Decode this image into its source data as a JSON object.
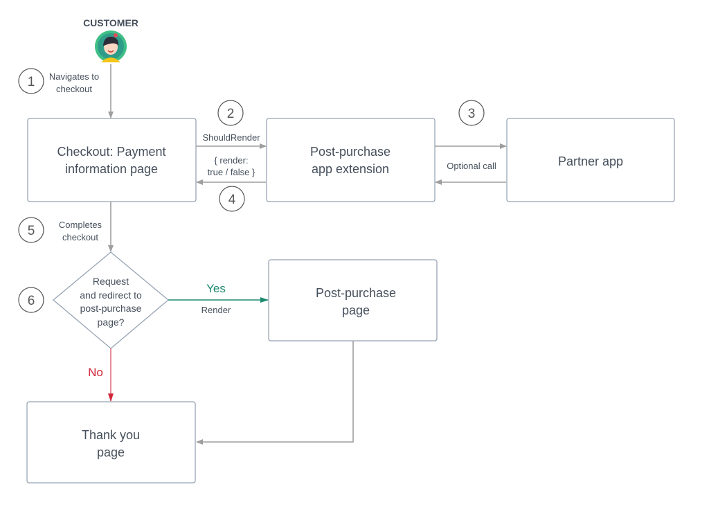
{
  "actor": {
    "label": "CUSTOMER",
    "icon": "customer-avatar-icon"
  },
  "nodes": {
    "checkout": [
      "Checkout: Payment",
      "information page"
    ],
    "extension": [
      "Post-purchase",
      "app extension"
    ],
    "partner": [
      "Partner app"
    ],
    "decision": [
      "Request",
      "and redirect to",
      "post-purchase",
      "page?"
    ],
    "post_purchase_page": [
      "Post-purchase",
      "page"
    ],
    "thank_you": [
      "Thank you",
      "page"
    ]
  },
  "steps": [
    "1",
    "2",
    "3",
    "4",
    "5",
    "6"
  ],
  "edges": {
    "navigates": [
      "Navigates to",
      "checkout"
    ],
    "should_render": "ShouldRender",
    "render_response": [
      "{ render:",
      "true / false }"
    ],
    "optional_call": "Optional call",
    "completes": [
      "Completes",
      "checkout"
    ],
    "yes": "Yes",
    "render": "Render",
    "no": "No"
  },
  "colors": {
    "yes": "#1f8a70",
    "no": "#d0263a",
    "neutral": "#9e9e9e",
    "box_border": "#98a4b3"
  }
}
